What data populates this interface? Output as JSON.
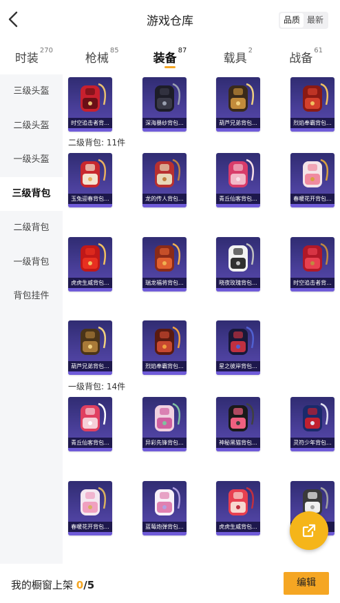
{
  "header": {
    "title": "游戏仓库",
    "sort_options": [
      "品质",
      "最新"
    ],
    "sort_active": 0
  },
  "tabs": [
    {
      "label": "时装",
      "count": "270"
    },
    {
      "label": "枪械",
      "count": "85"
    },
    {
      "label": "装备",
      "count": "87"
    },
    {
      "label": "载具",
      "count": "2"
    },
    {
      "label": "战备",
      "count": "61"
    }
  ],
  "active_tab": 2,
  "sidebar": {
    "items": [
      "三级头盔",
      "二级头盔",
      "一级头盔",
      "三级背包",
      "二级背包",
      "一级背包",
      "背包挂件"
    ],
    "active": 3
  },
  "sections": {
    "level2": "二级背包: 11件",
    "level1": "一级背包: 14件"
  },
  "rows": [
    [
      "时空追击者背...",
      "深海暴纱背包...",
      "葫芦兄弟背包...",
      "烈焰奉霸背包..."
    ],
    [
      "玉兔迎春背包...",
      "龙的传人背包...",
      "青丘仙客背包...",
      "春暖花开背包..."
    ],
    [
      "虎虎生威背包...",
      "瑞龙福将背包...",
      "晓夜玫瑰背包...",
      "时空追击者背..."
    ],
    [
      "葫芦兄弟背包...",
      "烈焰奉霸背包...",
      "星之彼岸背包..."
    ],
    [
      "青丘仙客背包...",
      "异彩先锋背包...",
      "神秘黑猫背包...",
      "灵符少年背包..."
    ],
    [
      "春暖花开背包...",
      "蓝莓炮弹背包...",
      "虎虎生威背包...",
      ""
    ]
  ],
  "bottom": {
    "label": "我的橱窗上架 ",
    "current": "0",
    "total": "/5",
    "edit_label": "编辑"
  },
  "colors": {
    "accent": "#f5a623",
    "card_bg": "#3a3386",
    "sidebar_bg": "#f5f6f8"
  }
}
